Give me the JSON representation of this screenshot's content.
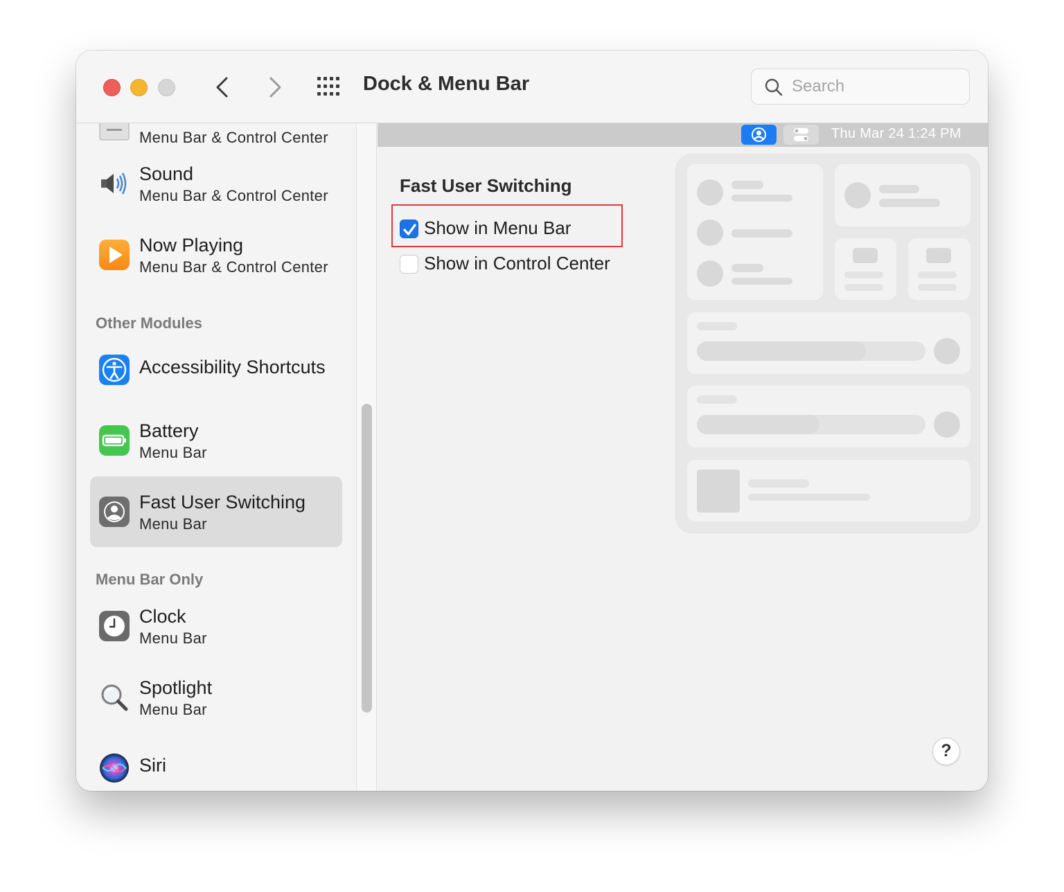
{
  "window": {
    "title": "Dock & Menu Bar",
    "search_placeholder": "Search"
  },
  "sidebar": {
    "partial_item": {
      "sub": "Menu Bar & Control Center"
    },
    "items": [
      {
        "title": "Sound",
        "sub": "Menu Bar & Control Center",
        "icon": "speaker-icon"
      },
      {
        "title": "Now Playing",
        "sub": "Menu Bar & Control Center",
        "icon": "play-icon"
      }
    ],
    "section_other": "Other Modules",
    "other_items": [
      {
        "title": "Accessibility Shortcuts",
        "icon": "accessibility-icon"
      },
      {
        "title": "Battery",
        "sub": "Menu Bar",
        "icon": "battery-icon"
      },
      {
        "title": "Fast User Switching",
        "sub": "Menu Bar",
        "icon": "user-icon",
        "selected": true
      }
    ],
    "section_menubar": "Menu Bar Only",
    "menubar_items": [
      {
        "title": "Clock",
        "sub": "Menu Bar",
        "icon": "clock-icon"
      },
      {
        "title": "Spotlight",
        "sub": "Menu Bar",
        "icon": "spotlight-icon"
      },
      {
        "title": "Siri",
        "icon": "siri-icon"
      }
    ]
  },
  "preview_menubar": {
    "datetime": "Thu Mar 24  1:24 PM"
  },
  "pane": {
    "heading": "Fast User Switching",
    "options": [
      {
        "label": "Show in Menu Bar",
        "checked": true
      },
      {
        "label": "Show in Control Center",
        "checked": false
      }
    ]
  },
  "help": {
    "label": "?"
  },
  "colors": {
    "accent": "#1a73e8",
    "highlight_border": "#e0383a",
    "close": "#ee5f57",
    "minimize": "#f4b631"
  }
}
